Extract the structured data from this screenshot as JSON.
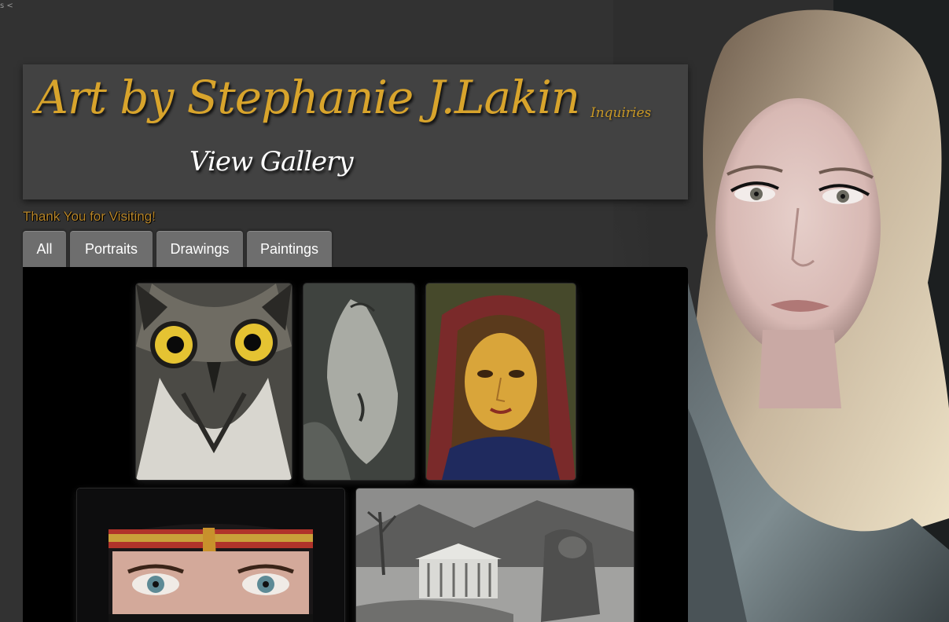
{
  "site": {
    "title": "Art by Stephanie J.Lakin",
    "inquiries_label": "Inquiries",
    "view_gallery_label": "View Gallery",
    "thanks_text": "Thank You for Visiting!",
    "corner_mark": "s <"
  },
  "tabs": [
    {
      "label": "All"
    },
    {
      "label": "Portraits"
    },
    {
      "label": "Drawings"
    },
    {
      "label": "Paintings"
    }
  ],
  "colors": {
    "page_bg": "#323232",
    "banner_bg": "#424242",
    "title_gold": "#d8a42c",
    "tab_bg": "#6e6e6e",
    "gallery_bg": "#000000"
  },
  "gallery": {
    "items": [
      {
        "subject": "owl drawing"
      },
      {
        "subject": "seal drawing"
      },
      {
        "subject": "madonna painting"
      },
      {
        "subject": "veiled woman portrait"
      },
      {
        "subject": "greek temple drawing"
      }
    ]
  }
}
